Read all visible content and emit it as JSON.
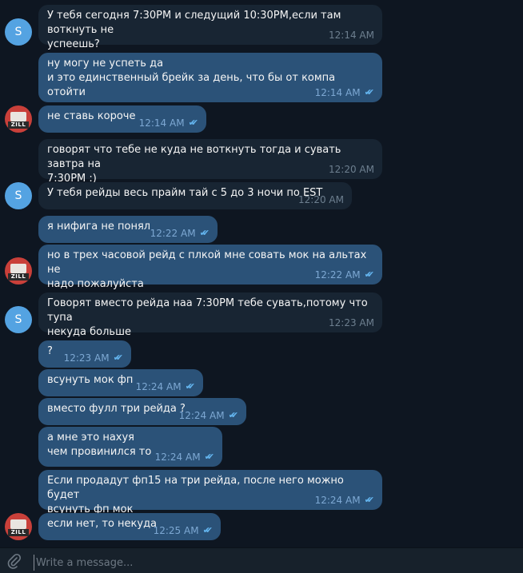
{
  "messages": [
    {
      "dir": "in",
      "text": "У тебя сегодня 7:30PM и следущий 10:30PM,если там воткнуть не\nуспеешь?",
      "time": "12:14 AM",
      "read": false
    },
    {
      "dir": "out",
      "text": "ну могу не успеть да\nи это единственный брейк за день, что бы от компа отойти",
      "time": "12:14 AM",
      "read": true
    },
    {
      "dir": "out",
      "text": "не ставь короче",
      "time": "12:14 AM",
      "read": true
    },
    {
      "dir": "in",
      "text": "говорят что тебе не куда не воткнуть тогда и сувать завтра на\n7:30PM :)",
      "time": "12:20 AM",
      "read": false
    },
    {
      "dir": "in",
      "text": "У тебя рейды весь прайм тай с 5 до 3 ночи по EST",
      "time": "12:20 AM",
      "read": false
    },
    {
      "dir": "out",
      "text": "я нифига не понял",
      "time": "12:22 AM",
      "read": true
    },
    {
      "dir": "out",
      "text": "но в трех часовой рейд с плкой мне совать мок на альтах не\nнадо пожалуйста",
      "time": "12:22 AM",
      "read": true
    },
    {
      "dir": "in",
      "text": "Говорят вместо рейда наа 7:30PM тебе сувать,потому что тупа\nнекуда больше",
      "time": "12:23 AM",
      "read": false
    },
    {
      "dir": "out",
      "text": "?",
      "time": "12:23 AM",
      "read": true
    },
    {
      "dir": "out",
      "text": "всунуть мок фп",
      "time": "12:24 AM",
      "read": true
    },
    {
      "dir": "out",
      "text": "вместо фулл три рейда ?",
      "time": "12:24 AM",
      "read": true
    },
    {
      "dir": "out",
      "text": "а мне это нахуя\nчем провинился то",
      "time": "12:24 AM",
      "read": true
    },
    {
      "dir": "out",
      "text": "Если продадут фп15 на три рейда, после него можно будет\nвсунуть фп мок",
      "time": "12:24 AM",
      "read": true
    },
    {
      "dir": "out",
      "text": "если нет, то некуда",
      "time": "12:25 AM",
      "read": true
    }
  ],
  "avatars": [
    {
      "kind": "s",
      "letter": "S"
    },
    {
      "kind": "z",
      "label": "ZILL"
    },
    {
      "kind": "s",
      "letter": "S"
    },
    {
      "kind": "z",
      "label": "ZILL"
    },
    {
      "kind": "s",
      "letter": "S"
    },
    {
      "kind": "z",
      "label": "ZILL"
    }
  ],
  "composer": {
    "placeholder": "Write a message..."
  },
  "colors": {
    "background": "#0e1621",
    "incoming": "#182533",
    "outgoing": "#2b5278",
    "read_check": "#64b5ef"
  }
}
